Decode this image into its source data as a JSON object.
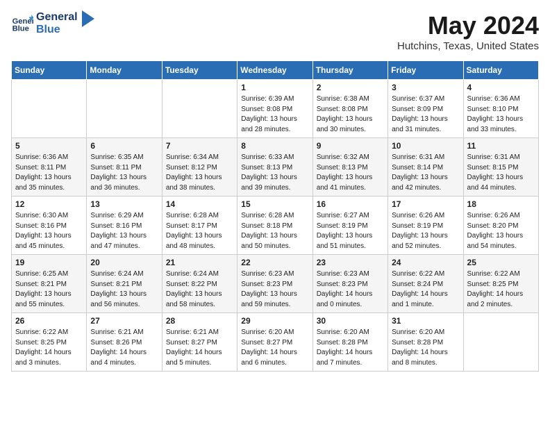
{
  "header": {
    "logo_line1": "General",
    "logo_line2": "Blue",
    "month": "May 2024",
    "location": "Hutchins, Texas, United States"
  },
  "days_of_week": [
    "Sunday",
    "Monday",
    "Tuesday",
    "Wednesday",
    "Thursday",
    "Friday",
    "Saturday"
  ],
  "weeks": [
    [
      {
        "day": "",
        "info": ""
      },
      {
        "day": "",
        "info": ""
      },
      {
        "day": "",
        "info": ""
      },
      {
        "day": "1",
        "info": "Sunrise: 6:39 AM\nSunset: 8:08 PM\nDaylight: 13 hours\nand 28 minutes."
      },
      {
        "day": "2",
        "info": "Sunrise: 6:38 AM\nSunset: 8:08 PM\nDaylight: 13 hours\nand 30 minutes."
      },
      {
        "day": "3",
        "info": "Sunrise: 6:37 AM\nSunset: 8:09 PM\nDaylight: 13 hours\nand 31 minutes."
      },
      {
        "day": "4",
        "info": "Sunrise: 6:36 AM\nSunset: 8:10 PM\nDaylight: 13 hours\nand 33 minutes."
      }
    ],
    [
      {
        "day": "5",
        "info": "Sunrise: 6:36 AM\nSunset: 8:11 PM\nDaylight: 13 hours\nand 35 minutes."
      },
      {
        "day": "6",
        "info": "Sunrise: 6:35 AM\nSunset: 8:11 PM\nDaylight: 13 hours\nand 36 minutes."
      },
      {
        "day": "7",
        "info": "Sunrise: 6:34 AM\nSunset: 8:12 PM\nDaylight: 13 hours\nand 38 minutes."
      },
      {
        "day": "8",
        "info": "Sunrise: 6:33 AM\nSunset: 8:13 PM\nDaylight: 13 hours\nand 39 minutes."
      },
      {
        "day": "9",
        "info": "Sunrise: 6:32 AM\nSunset: 8:13 PM\nDaylight: 13 hours\nand 41 minutes."
      },
      {
        "day": "10",
        "info": "Sunrise: 6:31 AM\nSunset: 8:14 PM\nDaylight: 13 hours\nand 42 minutes."
      },
      {
        "day": "11",
        "info": "Sunrise: 6:31 AM\nSunset: 8:15 PM\nDaylight: 13 hours\nand 44 minutes."
      }
    ],
    [
      {
        "day": "12",
        "info": "Sunrise: 6:30 AM\nSunset: 8:16 PM\nDaylight: 13 hours\nand 45 minutes."
      },
      {
        "day": "13",
        "info": "Sunrise: 6:29 AM\nSunset: 8:16 PM\nDaylight: 13 hours\nand 47 minutes."
      },
      {
        "day": "14",
        "info": "Sunrise: 6:28 AM\nSunset: 8:17 PM\nDaylight: 13 hours\nand 48 minutes."
      },
      {
        "day": "15",
        "info": "Sunrise: 6:28 AM\nSunset: 8:18 PM\nDaylight: 13 hours\nand 50 minutes."
      },
      {
        "day": "16",
        "info": "Sunrise: 6:27 AM\nSunset: 8:19 PM\nDaylight: 13 hours\nand 51 minutes."
      },
      {
        "day": "17",
        "info": "Sunrise: 6:26 AM\nSunset: 8:19 PM\nDaylight: 13 hours\nand 52 minutes."
      },
      {
        "day": "18",
        "info": "Sunrise: 6:26 AM\nSunset: 8:20 PM\nDaylight: 13 hours\nand 54 minutes."
      }
    ],
    [
      {
        "day": "19",
        "info": "Sunrise: 6:25 AM\nSunset: 8:21 PM\nDaylight: 13 hours\nand 55 minutes."
      },
      {
        "day": "20",
        "info": "Sunrise: 6:24 AM\nSunset: 8:21 PM\nDaylight: 13 hours\nand 56 minutes."
      },
      {
        "day": "21",
        "info": "Sunrise: 6:24 AM\nSunset: 8:22 PM\nDaylight: 13 hours\nand 58 minutes."
      },
      {
        "day": "22",
        "info": "Sunrise: 6:23 AM\nSunset: 8:23 PM\nDaylight: 13 hours\nand 59 minutes."
      },
      {
        "day": "23",
        "info": "Sunrise: 6:23 AM\nSunset: 8:23 PM\nDaylight: 14 hours\nand 0 minutes."
      },
      {
        "day": "24",
        "info": "Sunrise: 6:22 AM\nSunset: 8:24 PM\nDaylight: 14 hours\nand 1 minute."
      },
      {
        "day": "25",
        "info": "Sunrise: 6:22 AM\nSunset: 8:25 PM\nDaylight: 14 hours\nand 2 minutes."
      }
    ],
    [
      {
        "day": "26",
        "info": "Sunrise: 6:22 AM\nSunset: 8:25 PM\nDaylight: 14 hours\nand 3 minutes."
      },
      {
        "day": "27",
        "info": "Sunrise: 6:21 AM\nSunset: 8:26 PM\nDaylight: 14 hours\nand 4 minutes."
      },
      {
        "day": "28",
        "info": "Sunrise: 6:21 AM\nSunset: 8:27 PM\nDaylight: 14 hours\nand 5 minutes."
      },
      {
        "day": "29",
        "info": "Sunrise: 6:20 AM\nSunset: 8:27 PM\nDaylight: 14 hours\nand 6 minutes."
      },
      {
        "day": "30",
        "info": "Sunrise: 6:20 AM\nSunset: 8:28 PM\nDaylight: 14 hours\nand 7 minutes."
      },
      {
        "day": "31",
        "info": "Sunrise: 6:20 AM\nSunset: 8:28 PM\nDaylight: 14 hours\nand 8 minutes."
      },
      {
        "day": "",
        "info": ""
      }
    ]
  ]
}
